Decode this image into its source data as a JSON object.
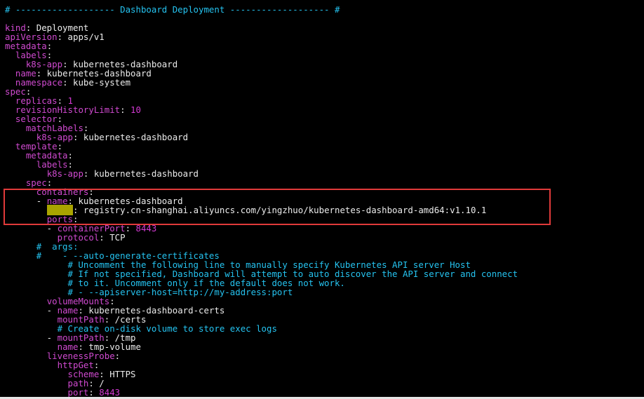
{
  "lines": [
    {
      "parts": [
        {
          "c": "cm",
          "t": "# ------------------- Dashboard Deployment ------------------- #"
        }
      ]
    },
    {
      "parts": []
    },
    {
      "parts": [
        {
          "c": "key",
          "t": "kind"
        },
        {
          "c": "wt",
          "t": ": Deployment"
        }
      ]
    },
    {
      "parts": [
        {
          "c": "key",
          "t": "apiVersion"
        },
        {
          "c": "wt",
          "t": ": apps/v1"
        }
      ]
    },
    {
      "parts": [
        {
          "c": "key",
          "t": "metadata"
        },
        {
          "c": "wt",
          "t": ":"
        }
      ]
    },
    {
      "parts": [
        {
          "c": "wt",
          "t": "  "
        },
        {
          "c": "key",
          "t": "labels"
        },
        {
          "c": "wt",
          "t": ":"
        }
      ]
    },
    {
      "parts": [
        {
          "c": "wt",
          "t": "    "
        },
        {
          "c": "key",
          "t": "k8s-app"
        },
        {
          "c": "wt",
          "t": ": kubernetes-dashboard"
        }
      ]
    },
    {
      "parts": [
        {
          "c": "wt",
          "t": "  "
        },
        {
          "c": "key",
          "t": "name"
        },
        {
          "c": "wt",
          "t": ": kubernetes-dashboard"
        }
      ]
    },
    {
      "parts": [
        {
          "c": "wt",
          "t": "  "
        },
        {
          "c": "key",
          "t": "namespace"
        },
        {
          "c": "wt",
          "t": ": kube-system"
        }
      ]
    },
    {
      "parts": [
        {
          "c": "key",
          "t": "spec"
        },
        {
          "c": "wt",
          "t": ":"
        }
      ]
    },
    {
      "parts": [
        {
          "c": "wt",
          "t": "  "
        },
        {
          "c": "key",
          "t": "replicas"
        },
        {
          "c": "wt",
          "t": ": "
        },
        {
          "c": "num",
          "t": "1"
        }
      ]
    },
    {
      "parts": [
        {
          "c": "wt",
          "t": "  "
        },
        {
          "c": "key",
          "t": "revisionHistoryLimit"
        },
        {
          "c": "wt",
          "t": ": "
        },
        {
          "c": "num",
          "t": "10"
        }
      ]
    },
    {
      "parts": [
        {
          "c": "wt",
          "t": "  "
        },
        {
          "c": "key",
          "t": "selector"
        },
        {
          "c": "wt",
          "t": ":"
        }
      ]
    },
    {
      "parts": [
        {
          "c": "wt",
          "t": "    "
        },
        {
          "c": "key",
          "t": "matchLabels"
        },
        {
          "c": "wt",
          "t": ":"
        }
      ]
    },
    {
      "parts": [
        {
          "c": "wt",
          "t": "      "
        },
        {
          "c": "key",
          "t": "k8s-app"
        },
        {
          "c": "wt",
          "t": ": kubernetes-dashboard"
        }
      ]
    },
    {
      "parts": [
        {
          "c": "wt",
          "t": "  "
        },
        {
          "c": "key",
          "t": "template"
        },
        {
          "c": "wt",
          "t": ":"
        }
      ]
    },
    {
      "parts": [
        {
          "c": "wt",
          "t": "    "
        },
        {
          "c": "key",
          "t": "metadata"
        },
        {
          "c": "wt",
          "t": ":"
        }
      ]
    },
    {
      "parts": [
        {
          "c": "wt",
          "t": "      "
        },
        {
          "c": "key",
          "t": "labels"
        },
        {
          "c": "wt",
          "t": ":"
        }
      ]
    },
    {
      "parts": [
        {
          "c": "wt",
          "t": "        "
        },
        {
          "c": "key",
          "t": "k8s-app"
        },
        {
          "c": "wt",
          "t": ": kubernetes-dashboard"
        }
      ]
    },
    {
      "parts": [
        {
          "c": "wt",
          "t": "    "
        },
        {
          "c": "key",
          "t": "spec"
        },
        {
          "c": "wt",
          "t": ":"
        }
      ]
    },
    {
      "parts": [
        {
          "c": "wt",
          "t": "      "
        },
        {
          "c": "key",
          "t": "containers"
        },
        {
          "c": "wt",
          "t": ":"
        }
      ]
    },
    {
      "parts": [
        {
          "c": "wt",
          "t": "      - "
        },
        {
          "c": "key",
          "t": "name"
        },
        {
          "c": "wt",
          "t": ": kubernetes-dashboard"
        }
      ]
    },
    {
      "parts": [
        {
          "c": "wt",
          "t": "        "
        },
        {
          "c": "hl",
          "t": "image"
        },
        {
          "c": "wt",
          "t": ": registry.cn-shanghai.aliyuncs.com/yingzhuo/kubernetes-dashboard-amd64:v1.10.1"
        }
      ]
    },
    {
      "parts": [
        {
          "c": "wt",
          "t": "        "
        },
        {
          "c": "key",
          "t": "ports"
        },
        {
          "c": "wt",
          "t": ":"
        }
      ]
    },
    {
      "parts": [
        {
          "c": "wt",
          "t": "        - "
        },
        {
          "c": "key",
          "t": "containerPort"
        },
        {
          "c": "wt",
          "t": ": "
        },
        {
          "c": "num",
          "t": "8443"
        }
      ]
    },
    {
      "parts": [
        {
          "c": "wt",
          "t": "          "
        },
        {
          "c": "key",
          "t": "protocol"
        },
        {
          "c": "wt",
          "t": ": TCP"
        }
      ]
    },
    {
      "parts": [
        {
          "c": "cm",
          "t": "      #  args:"
        }
      ]
    },
    {
      "parts": [
        {
          "c": "cm",
          "t": "      #    - --auto-generate-certificates"
        }
      ]
    },
    {
      "parts": [
        {
          "c": "cm",
          "t": "            # Uncomment the following line to manually specify Kubernetes API server Host"
        }
      ]
    },
    {
      "parts": [
        {
          "c": "cm",
          "t": "            # If not specified, Dashboard will attempt to auto discover the API server and connect"
        }
      ]
    },
    {
      "parts": [
        {
          "c": "cm",
          "t": "            # to it. Uncomment only if the default does not work."
        }
      ]
    },
    {
      "parts": [
        {
          "c": "cm",
          "t": "            # - --apiserver-host=http://my-address:port"
        }
      ]
    },
    {
      "parts": [
        {
          "c": "wt",
          "t": "        "
        },
        {
          "c": "key",
          "t": "volumeMounts"
        },
        {
          "c": "wt",
          "t": ":"
        }
      ]
    },
    {
      "parts": [
        {
          "c": "wt",
          "t": "        - "
        },
        {
          "c": "key",
          "t": "name"
        },
        {
          "c": "wt",
          "t": ": kubernetes-dashboard-certs"
        }
      ]
    },
    {
      "parts": [
        {
          "c": "wt",
          "t": "          "
        },
        {
          "c": "key",
          "t": "mountPath"
        },
        {
          "c": "wt",
          "t": ": /certs"
        }
      ]
    },
    {
      "parts": [
        {
          "c": "cm",
          "t": "          # Create on-disk volume to store exec logs"
        }
      ]
    },
    {
      "parts": [
        {
          "c": "wt",
          "t": "        - "
        },
        {
          "c": "key",
          "t": "mountPath"
        },
        {
          "c": "wt",
          "t": ": /tmp"
        }
      ]
    },
    {
      "parts": [
        {
          "c": "wt",
          "t": "          "
        },
        {
          "c": "key",
          "t": "name"
        },
        {
          "c": "wt",
          "t": ": tmp-volume"
        }
      ]
    },
    {
      "parts": [
        {
          "c": "wt",
          "t": "        "
        },
        {
          "c": "key",
          "t": "livenessProbe"
        },
        {
          "c": "wt",
          "t": ":"
        }
      ]
    },
    {
      "parts": [
        {
          "c": "wt",
          "t": "          "
        },
        {
          "c": "key",
          "t": "httpGet"
        },
        {
          "c": "wt",
          "t": ":"
        }
      ]
    },
    {
      "parts": [
        {
          "c": "wt",
          "t": "            "
        },
        {
          "c": "key",
          "t": "scheme"
        },
        {
          "c": "wt",
          "t": ": HTTPS"
        }
      ]
    },
    {
      "parts": [
        {
          "c": "wt",
          "t": "            "
        },
        {
          "c": "key",
          "t": "path"
        },
        {
          "c": "wt",
          "t": ": /"
        }
      ]
    },
    {
      "parts": [
        {
          "c": "wt",
          "t": "            "
        },
        {
          "c": "key",
          "t": "port"
        },
        {
          "c": "wt",
          "t": ": "
        },
        {
          "c": "num",
          "t": "8443"
        }
      ]
    }
  ]
}
